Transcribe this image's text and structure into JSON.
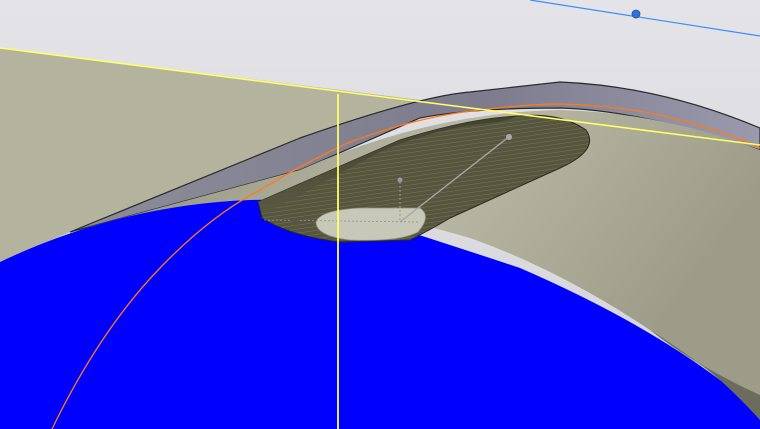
{
  "viewport": {
    "kind": "3d-cad-viewport",
    "colors": {
      "background_top": "#e4e4e8",
      "background_bottom": "#d4d4d8",
      "sphere": "#0000ff",
      "body_light": "#b9b9a6",
      "body_dark": "#8a8a78",
      "cut_pocket": "#4d4d3a",
      "pocket_floor": "#c8c8b8",
      "section_line": "#ffff66",
      "curve": "#ff7a1a",
      "construction_line": "#3d8cff",
      "construction_point": "#2f73d9",
      "axis_gray": "#a0a0a0"
    },
    "objects": [
      {
        "name": "blue-sphere-surface",
        "role": "solid body"
      },
      {
        "name": "swept-shell-body",
        "role": "solid body"
      },
      {
        "name": "slot-pocket-cut",
        "role": "cut feature"
      },
      {
        "name": "yellow-section-plane",
        "role": "section plane"
      },
      {
        "name": "orange-guide-curve",
        "role": "sketch curve"
      },
      {
        "name": "blue-construction-line",
        "role": "construction geometry"
      }
    ]
  }
}
